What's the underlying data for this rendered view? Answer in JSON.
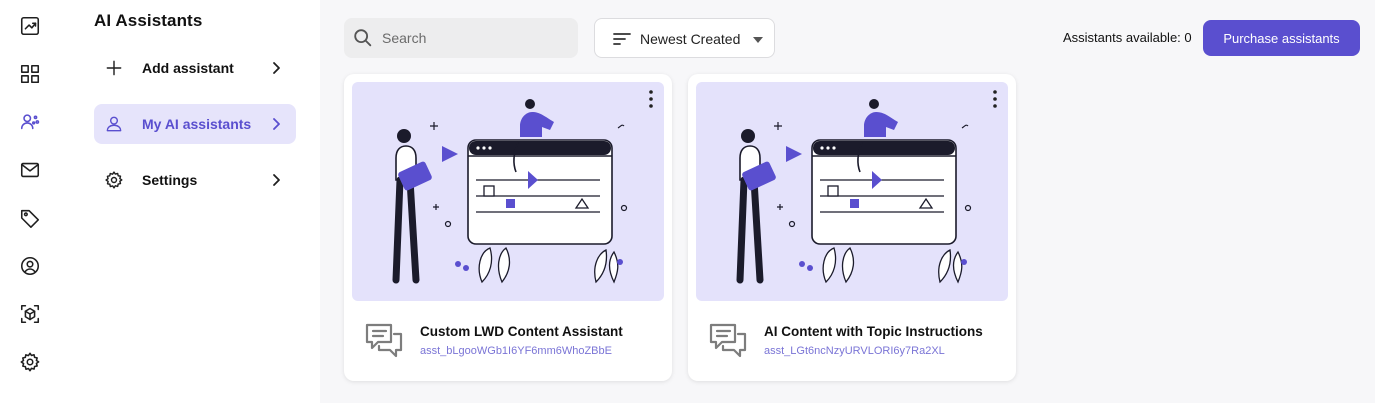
{
  "rail": {
    "items": [
      {
        "name": "analytics-icon"
      },
      {
        "name": "dashboard-icon"
      },
      {
        "name": "ai-assistant-icon",
        "active": true
      },
      {
        "name": "mail-icon"
      },
      {
        "name": "tag-icon"
      },
      {
        "name": "profile-icon"
      },
      {
        "name": "cube-icon"
      },
      {
        "name": "settings-gear-icon"
      }
    ]
  },
  "subnav": {
    "title": "AI Assistants",
    "items": [
      {
        "label": "Add assistant",
        "icon": "plus-icon"
      },
      {
        "label": "My AI assistants",
        "icon": "user-icon",
        "active": true
      },
      {
        "label": "Settings",
        "icon": "gear-icon"
      }
    ]
  },
  "toolbar": {
    "search_placeholder": "Search",
    "sort_label": "Newest Created",
    "available_text": "Assistants available: 0",
    "purchase_label": "Purchase assistants"
  },
  "cards": [
    {
      "title": "Custom LWD Content Assistant",
      "id": "asst_bLgooWGb1I6YF6mm6WhoZBbE"
    },
    {
      "title": "AI Content with Topic Instructions",
      "id": "asst_LGt6ncNzyURVLORI6y7Ra2XL"
    }
  ],
  "colors": {
    "accent": "#5a4fcf",
    "accent_soft": "#e6e4fb",
    "illustration_bg": "#e4e2fb",
    "id_text": "#7a74d6"
  }
}
